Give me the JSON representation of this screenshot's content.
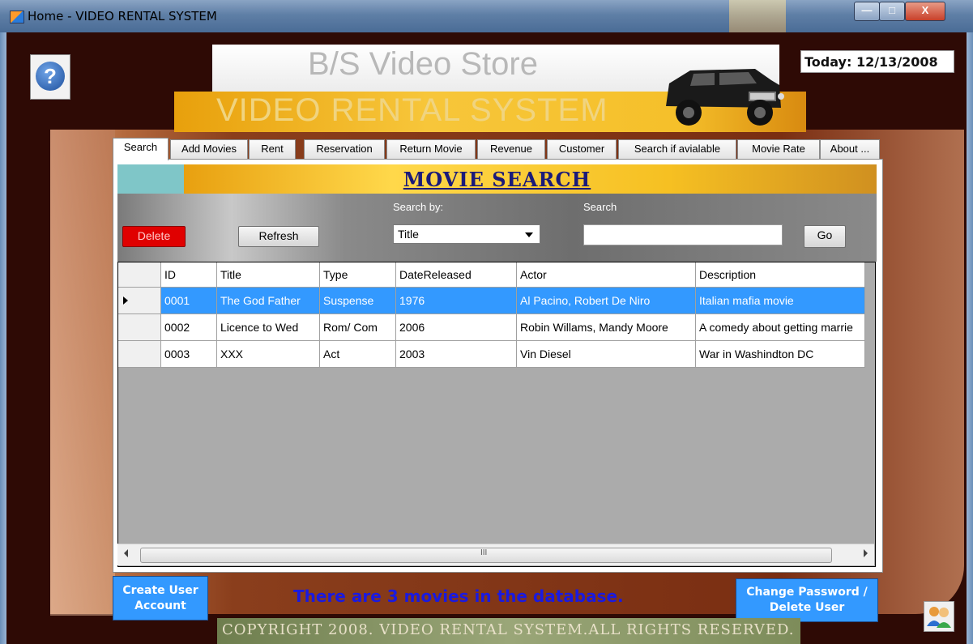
{
  "window": {
    "title": "Home - VIDEO RENTAL SYSTEM",
    "min_label": "—",
    "max_label": "□",
    "close_label": "X"
  },
  "header": {
    "store_name": "B/S Video Store",
    "system_name": "VIDEO RENTAL SYSTEM",
    "today": "Today: 12/13/2008",
    "help_glyph": "?"
  },
  "tabs": [
    {
      "label": "Search"
    },
    {
      "label": "Add Movies"
    },
    {
      "label": "Rent"
    },
    {
      "label": "Reservation"
    },
    {
      "label": "Return Movie"
    },
    {
      "label": "Revenue"
    },
    {
      "label": "Customer"
    },
    {
      "label": "Search if avialable"
    },
    {
      "label": "Movie Rate"
    },
    {
      "label": "About ..."
    }
  ],
  "search_panel": {
    "title": "MOVIE SEARCH",
    "delete_label": "Delete",
    "refresh_label": "Refresh",
    "search_by_label": "Search by:",
    "search_by_value": "Title",
    "search_label": "Search",
    "search_value": "",
    "go_label": "Go"
  },
  "grid": {
    "columns": [
      "ID",
      "Title",
      "Type",
      "DateReleased",
      "Actor",
      "Description"
    ],
    "rows": [
      [
        "0001",
        "The God Father",
        "Suspense",
        "1976",
        "Al Pacino, Robert De Niro",
        "Italian mafia movie"
      ],
      [
        "0002",
        "Licence to Wed",
        "Rom/ Com",
        "2006",
        "Robin Willams, Mandy Moore",
        "A comedy about getting marrie"
      ],
      [
        "0003",
        "XXX",
        "Act",
        "2003",
        "Vin Diesel",
        "War in Washindton DC"
      ]
    ],
    "selected_row": 0,
    "scroll_grip": "III"
  },
  "footer": {
    "create_user_label": "Create User Account",
    "count_message": "There are 3 movies in the database.",
    "change_password_label": "Change Password / Delete User",
    "copyright": "COPYRIGHT 2008. VIDEO RENTAL SYSTEM.ALL RIGHTS  RESERVED."
  },
  "icons": {
    "app": "app-icon",
    "help": "help-icon",
    "users": "users-icon",
    "jeep": "jeep-image"
  }
}
